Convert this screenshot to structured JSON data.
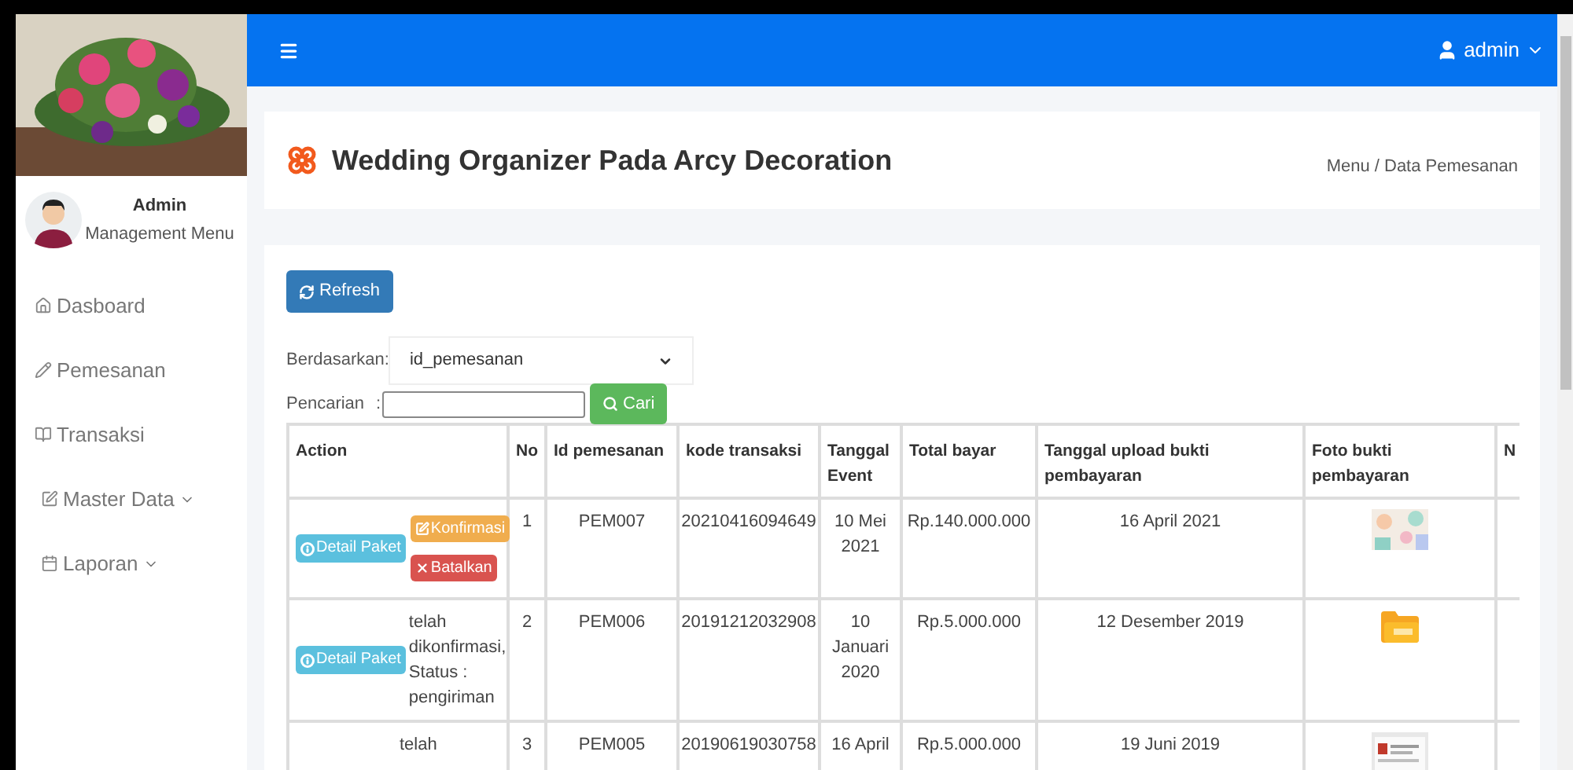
{
  "sidebar": {
    "user_name": "Admin",
    "user_role": "Management Menu",
    "items": [
      {
        "label": "Dasboard",
        "kind": "home",
        "expandable": false
      },
      {
        "label": "Pemesanan",
        "kind": "pencil",
        "expandable": false
      },
      {
        "label": "Transaksi",
        "kind": "book",
        "expandable": false
      },
      {
        "label": "Master Data",
        "kind": "edit",
        "expandable": true
      },
      {
        "label": "Laporan",
        "kind": "calendar",
        "expandable": true
      }
    ]
  },
  "topbar": {
    "user": "admin"
  },
  "header": {
    "title": "Wedding Organizer Pada Arcy Decoration",
    "breadcrumb": "Menu / Data Pemesanan"
  },
  "toolbar": {
    "refresh": "Refresh",
    "filter_label": "Berdasarkan:",
    "filter_value": "id_pemesanan",
    "search_label": "Pencarian",
    "search_separator": ":",
    "search_button": "Cari"
  },
  "table": {
    "columns": [
      "Action",
      "No",
      "Id pemesanan",
      "kode transaksi",
      "Tanggal Event",
      "Total bayar",
      "Tanggal upload bukti pembayaran",
      "Foto bukti pembayaran",
      "N"
    ],
    "rows": [
      {
        "detail_button": "Detail Paket",
        "actions": [
          {
            "kind": "confirm",
            "label": "Konfirmasi"
          },
          {
            "kind": "cancel",
            "label": "Batalkan"
          }
        ],
        "no": "1",
        "id": "PEM007",
        "code": "20210416094649",
        "event": "10 Mei 2021",
        "total": "Rp.140.000.000",
        "upload": "16 April 2021",
        "proof": {
          "kind": "picture"
        }
      },
      {
        "detail_button": "Detail Paket",
        "status": "telah dikonfirmasi, Status : pengiriman",
        "no": "2",
        "id": "PEM006",
        "code": "20191212032908",
        "event": "10 Januari 2020",
        "total": "Rp.5.000.000",
        "upload": "12 Desember 2019",
        "proof": {
          "kind": "file"
        }
      },
      {
        "status": "telah",
        "no": "3",
        "id": "PEM005",
        "code": "20190619030758",
        "event": "16 April",
        "total": "Rp.5.000.000",
        "upload": "19 Juni 2019",
        "proof": {
          "kind": "document"
        }
      }
    ]
  }
}
